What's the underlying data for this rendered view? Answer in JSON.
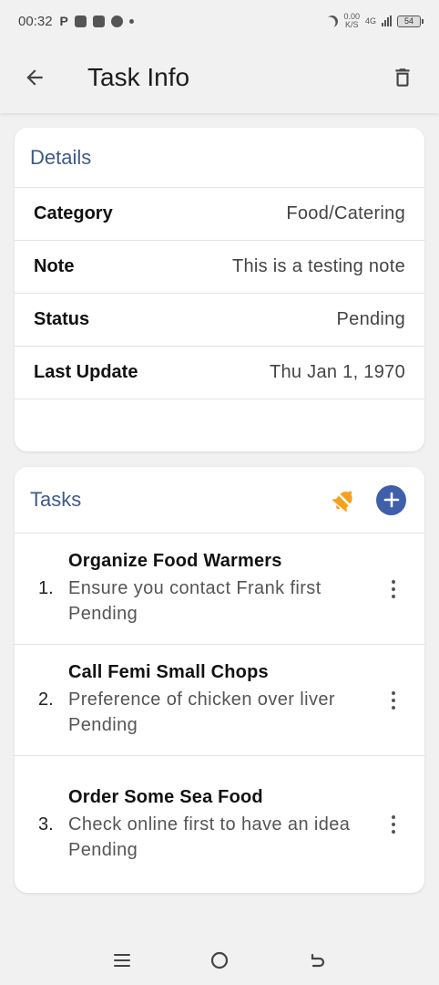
{
  "status_bar": {
    "time": "00:32",
    "p_label": "P",
    "network_speed_top": "0.00",
    "network_speed_bottom": "K/S",
    "network_type": "4G",
    "battery": "54"
  },
  "header": {
    "title": "Task Info",
    "icons": [
      "arrow-back-icon",
      "trash-icon"
    ]
  },
  "details": {
    "title": "Details",
    "rows": [
      {
        "label": "Category",
        "value": "Food/Catering"
      },
      {
        "label": "Note",
        "value": "This is a testing note"
      },
      {
        "label": "Status",
        "value": "Pending"
      },
      {
        "label": "Last Update",
        "value": "Thu Jan 1, 1970"
      }
    ]
  },
  "tasks": {
    "title": "Tasks",
    "accent_color": "#3f5fa9",
    "bell_color": "#f7a01e",
    "items": [
      {
        "number": "1.",
        "title": "Organize Food Warmers",
        "description": "Ensure you contact Frank first",
        "status": "Pending"
      },
      {
        "number": "2.",
        "title": "Call Femi Small Chops",
        "description": "Preference of chicken over liver",
        "status": "Pending"
      },
      {
        "number": "3.",
        "title": "Order Some Sea Food",
        "description": "Check online first to have an idea",
        "status": "Pending"
      }
    ]
  },
  "nav": {
    "icons": [
      "menu-icon",
      "home-icon",
      "back-icon"
    ]
  }
}
